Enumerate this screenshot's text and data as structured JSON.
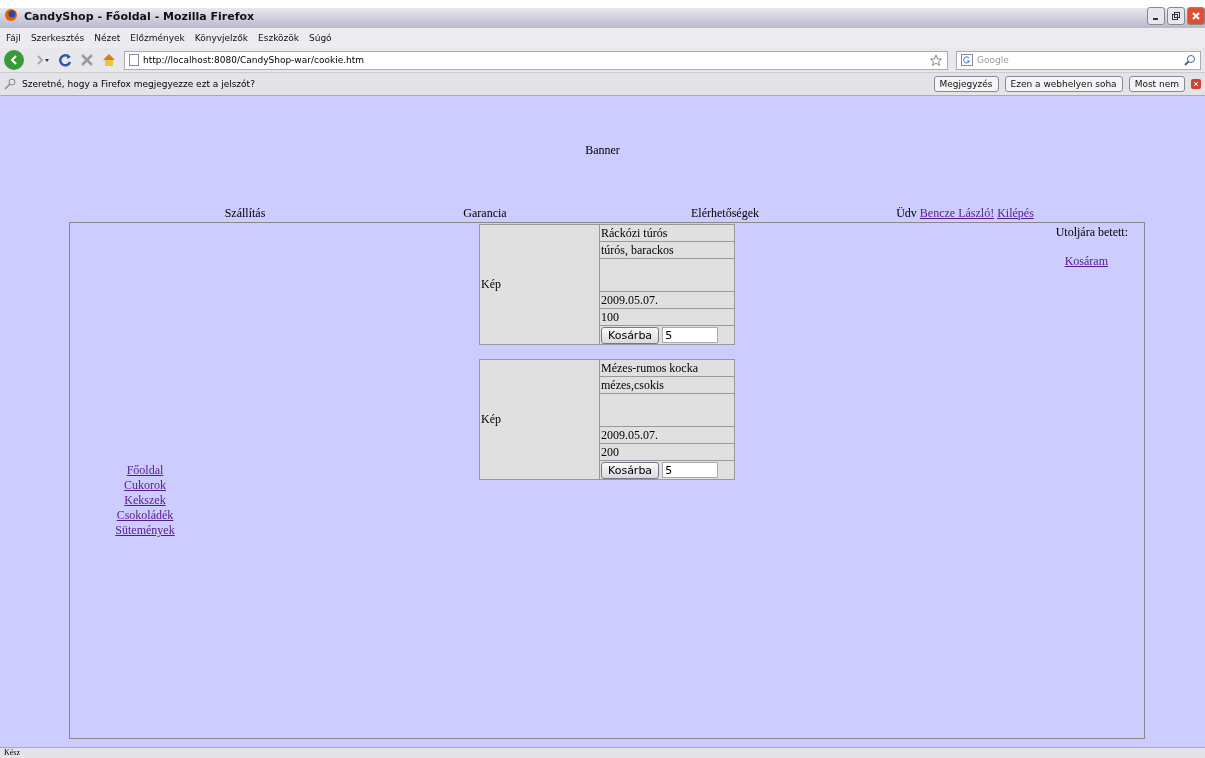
{
  "window": {
    "title": "CandyShop - Főoldal - Mozilla Firefox"
  },
  "menu": [
    "Fájl",
    "Szerkesztés",
    "Nézet",
    "Előzmények",
    "Könyvjelzők",
    "Eszközök",
    "Súgó"
  ],
  "address": {
    "value": "http://localhost:8080/CandyShop-war/cookie.htm"
  },
  "search": {
    "placeholder": "Google"
  },
  "notification": {
    "text": "Szeretné, hogy a Firefox megjegyezze ezt a jelszót?",
    "buttons": [
      "Megjegyzés",
      "Ezen a webhelyen soha",
      "Most nem"
    ]
  },
  "banner": "Banner",
  "nav": [
    {
      "kind": "text",
      "label": "Szállítás"
    },
    {
      "kind": "text",
      "label": "Garancia"
    },
    {
      "kind": "text",
      "label": "Elérhetőségek"
    },
    {
      "kind": "greeting",
      "label": "Üdv",
      "user": "Bencze László!",
      "logout": "Kilépés"
    }
  ],
  "sidebar": {
    "items": [
      "Főoldal",
      "Cukorok",
      "Kekszek",
      "Csokoládék",
      "Sütemények"
    ]
  },
  "products": [
    {
      "image": "Kép",
      "name": "Ráckózi túrós",
      "description": "túrós, barackos",
      "date": "2009.05.07.",
      "price": "100",
      "button": "Kosárba",
      "quantity": "5"
    },
    {
      "image": "Kép",
      "name": "Mézes-rumos kocka",
      "description": "mézes,csokis",
      "date": "2009.05.07.",
      "price": "200",
      "button": "Kosárba",
      "quantity": "5"
    }
  ],
  "cart": {
    "label": "Utoljára betett:",
    "link": "Kosáram"
  },
  "status_bar": "Kész"
}
